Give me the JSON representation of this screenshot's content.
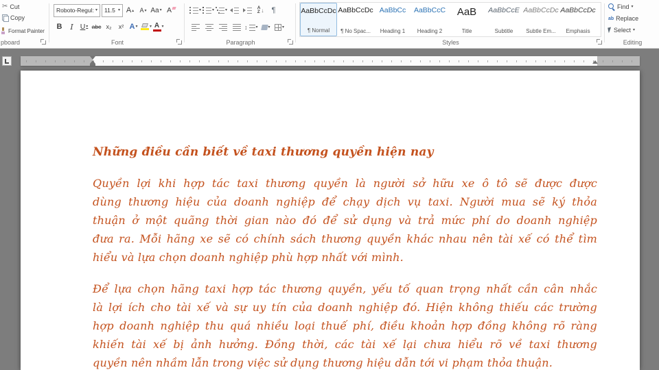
{
  "colors": {
    "document_text": "#c4521e",
    "heading_style_blue": "#2e74b5",
    "canvas_gray": "#7d7d7d",
    "highlight_yellow": "#ffe81a",
    "font_color_red": "#c00000"
  },
  "ribbon": {
    "clipboard": {
      "group_label": "pboard",
      "cut": "Cut",
      "copy": "Copy",
      "format_painter": "Format Painter"
    },
    "font": {
      "group_label": "Font",
      "font_name": "Roboto-Regul:",
      "font_size": "11.5",
      "grow_font": "A",
      "shrink_font": "A",
      "change_case": "Aa",
      "clear_formatting": "A",
      "bold": "B",
      "italic": "I",
      "underline": "U",
      "strikethrough": "abc",
      "subscript": "x₂",
      "superscript": "x²",
      "text_effects": "A",
      "font_color": "A"
    },
    "paragraph": {
      "group_label": "Paragraph",
      "sort_top": "A",
      "sort_bottom": "Z",
      "show_hide": "¶"
    },
    "styles": {
      "group_label": "Styles",
      "items": [
        {
          "preview": "AaBbCcDc",
          "name": "¶ Normal"
        },
        {
          "preview": "AaBbCcDc",
          "name": "¶ No Spac..."
        },
        {
          "preview": "AaBbCc",
          "name": "Heading 1"
        },
        {
          "preview": "AaBbCcC",
          "name": "Heading 2"
        },
        {
          "preview": "AaB",
          "name": "Title"
        },
        {
          "preview": "AaBbCcE",
          "name": "Subtitle"
        },
        {
          "preview": "AaBbCcDc",
          "name": "Subtle Em..."
        },
        {
          "preview": "AaBbCcDc",
          "name": "Emphasis"
        }
      ]
    },
    "editing": {
      "group_label": "Editing",
      "find": "Find",
      "replace": "Replace",
      "select": "Select"
    }
  },
  "document": {
    "title": "Những điều cần biết về taxi thương quyền hiện nay",
    "paragraphs": [
      {
        "lines": [
          "Quyền lợi khi hợp tác taxi thương quyền là người sở hữu xe ô tô sẽ được được",
          "dùng thương hiệu của doanh nghiệp để chạy dịch vụ taxi. Người mua sẽ ký thỏa",
          "thuận ở một quãng thời gian nào đó để sử dụng và trả mức phí do doanh nghiệp",
          "đưa ra. Mỗi hãng xe sẽ có chính sách thương quyền khác nhau nên tài xế có thể tìm",
          "hiểu và lựa chọn doanh nghiệp phù hợp nhất với mình."
        ]
      },
      {
        "lines": [
          "Để lựa chọn hãng taxi hợp tác thương quyền, yếu tố quan trọng nhất cần cân nhắc",
          "là lợi ích cho tài xế và sự uy tín của doanh nghiệp đó. Hiện không thiếu các trường",
          "hợp doanh nghiệp thu quá nhiều loại thuế phí, điều khoản hợp đồng không rõ ràng",
          "khiến tài xế bị ảnh hưởng. Đồng thời, các tài xế lại chưa hiểu rõ về taxi thương",
          "quyền nên nhầm lẫn trong việc sử dụng thương hiệu dẫn tới vi phạm thỏa thuận."
        ]
      }
    ]
  }
}
